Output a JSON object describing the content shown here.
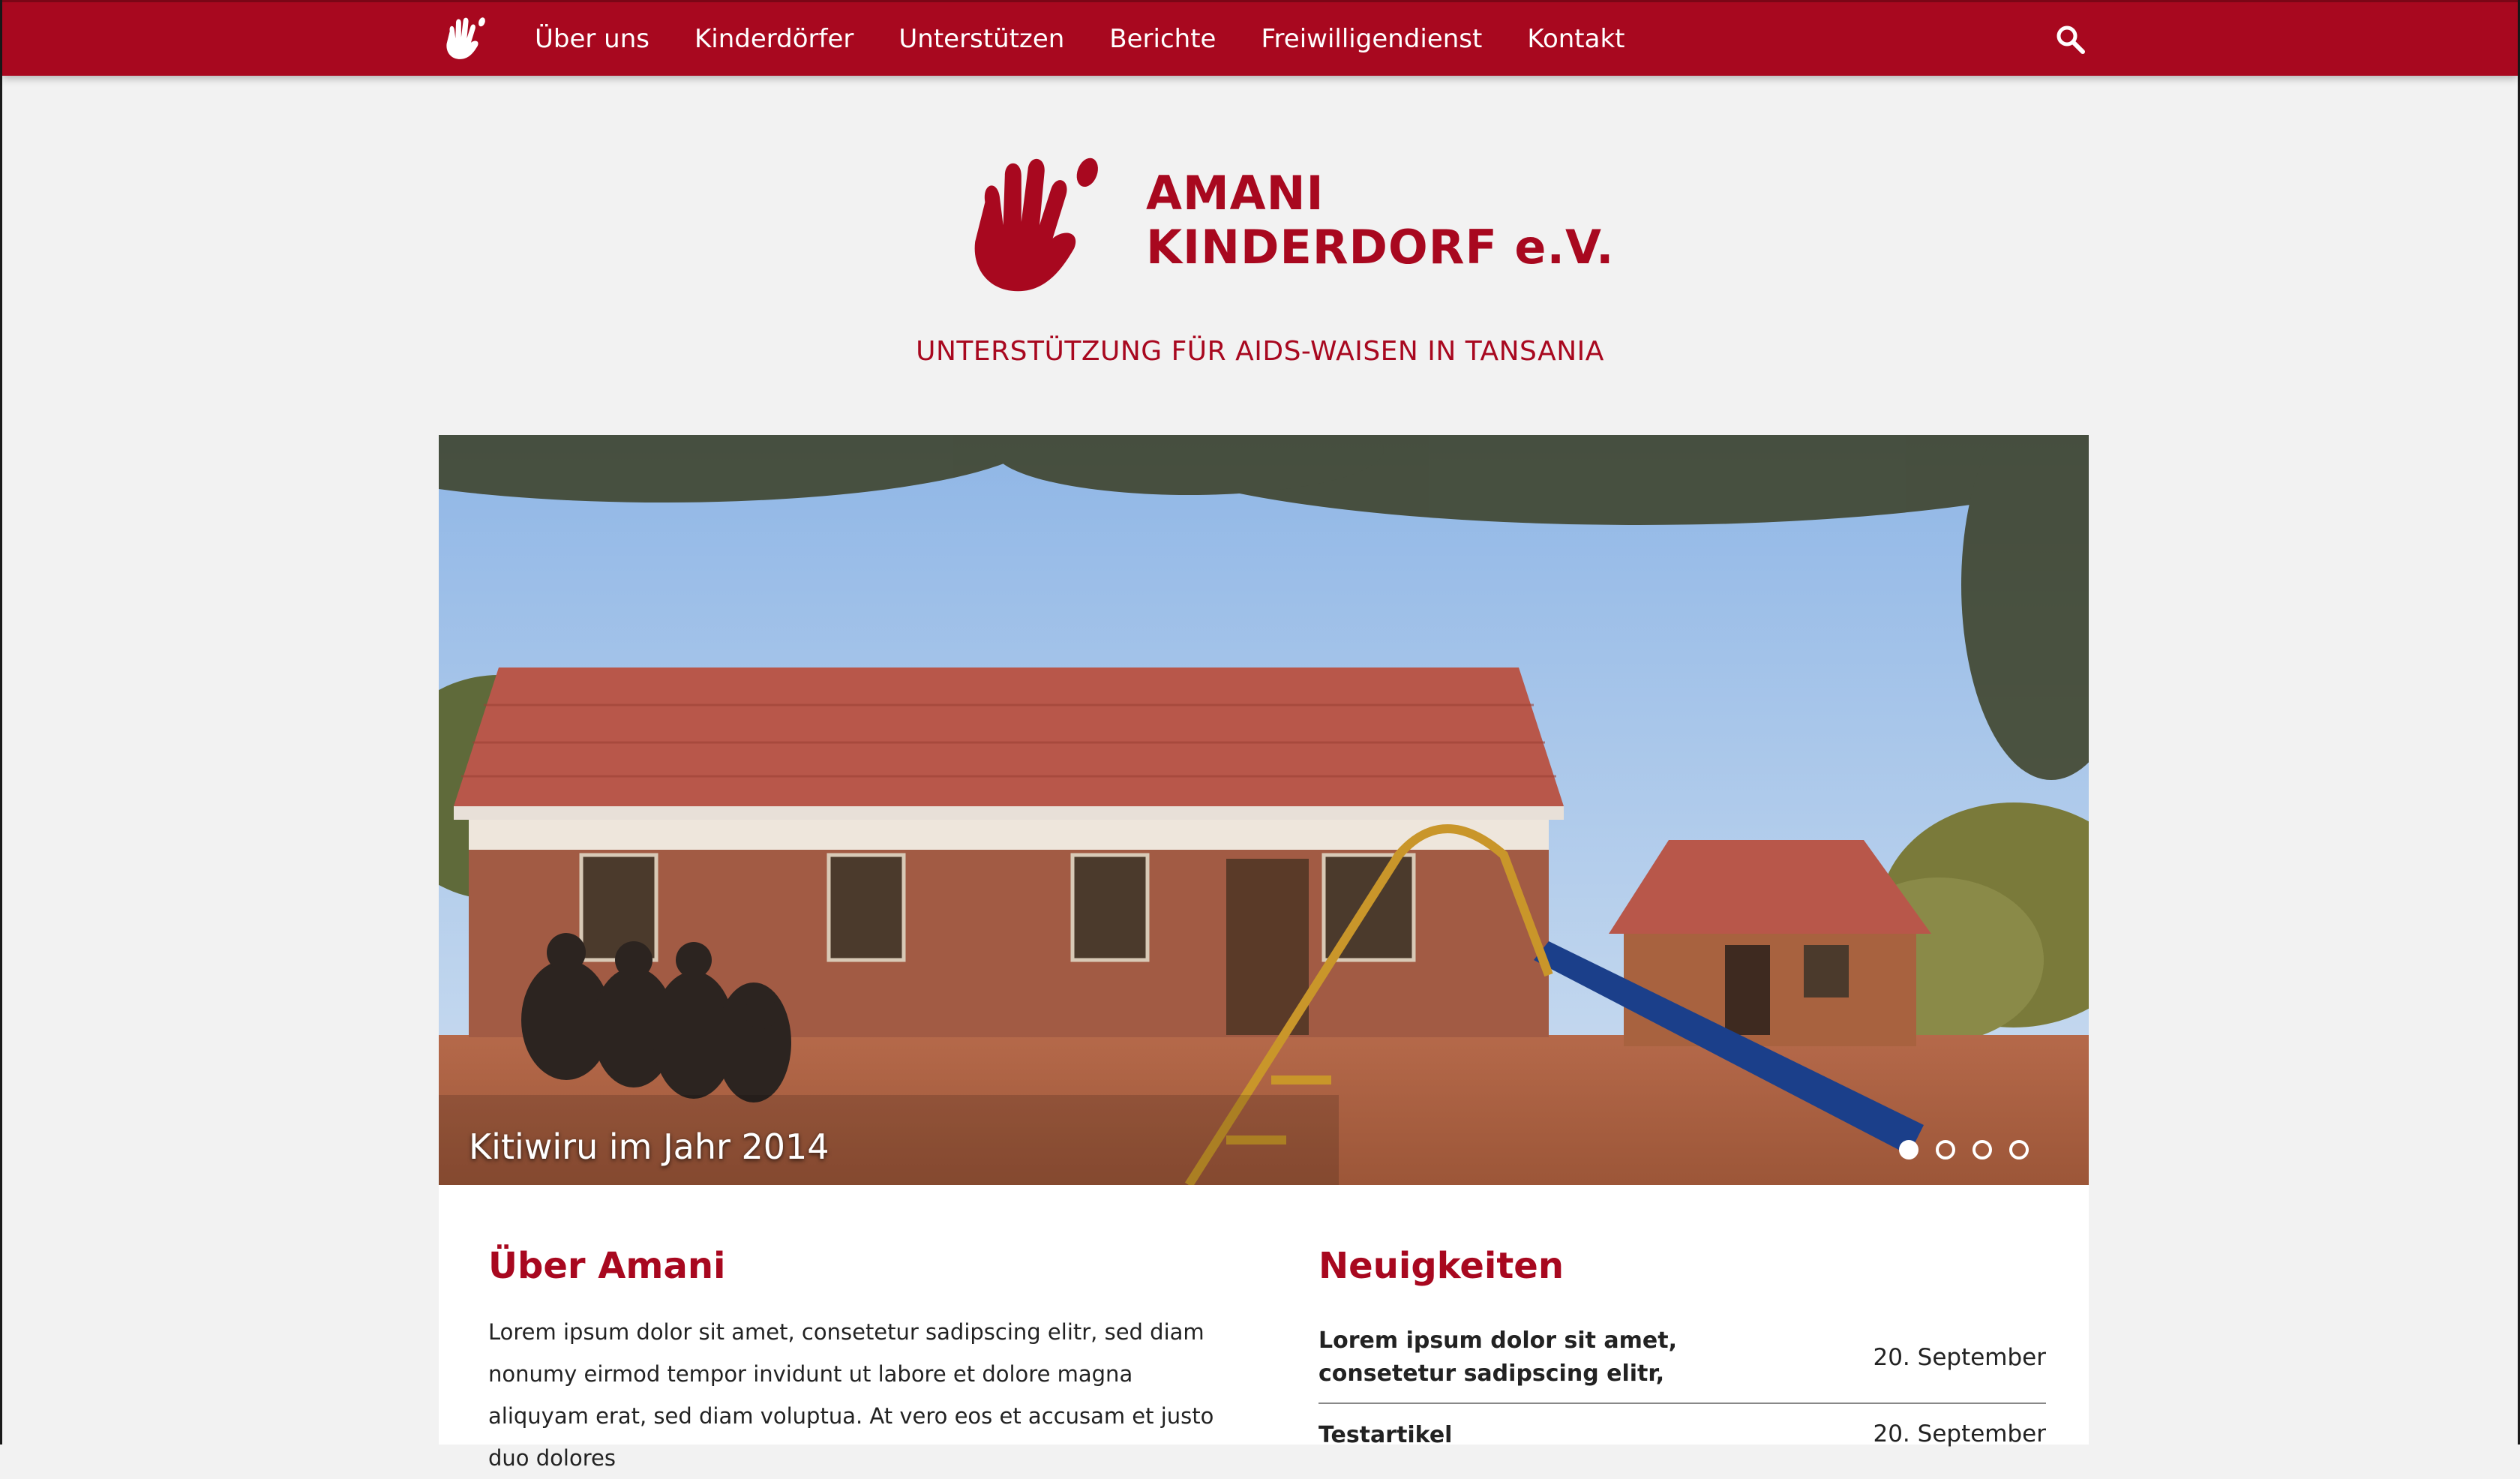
{
  "nav": {
    "items": [
      {
        "label": "Über uns"
      },
      {
        "label": "Kinderdörfer"
      },
      {
        "label": "Unterstützen"
      },
      {
        "label": "Berichte"
      },
      {
        "label": "Freiwilligendienst"
      },
      {
        "label": "Kontakt"
      }
    ],
    "logo_icon": "hand-icon",
    "search_icon": "search-icon"
  },
  "brand": {
    "name_line1": "AMANI",
    "name_line2": "KINDERDORF e.V.",
    "tagline": "UNTERSTÜTZUNG FÜR AIDS-WAISEN IN TANSANIA"
  },
  "slider": {
    "caption": "Kitiwiru im Jahr 2014",
    "slide_count": 4,
    "active_index": 0
  },
  "about": {
    "title": "Über Amani",
    "text": "Lorem ipsum dolor sit amet, consetetur sadipscing elitr, sed diam nonumy eirmod tempor invidunt ut labore et dolore magna aliquyam erat, sed diam voluptua. At vero eos et accusam et justo duo dolores"
  },
  "news": {
    "title": "Neuigkeiten",
    "items": [
      {
        "title": "Lorem ipsum dolor sit amet, consetetur sadipscing elitr,",
        "date": "20. September"
      },
      {
        "title": "Testartikel",
        "date": "20. September"
      }
    ]
  },
  "colors": {
    "brand_red": "#a8081f",
    "background": "#f2f2f2"
  }
}
